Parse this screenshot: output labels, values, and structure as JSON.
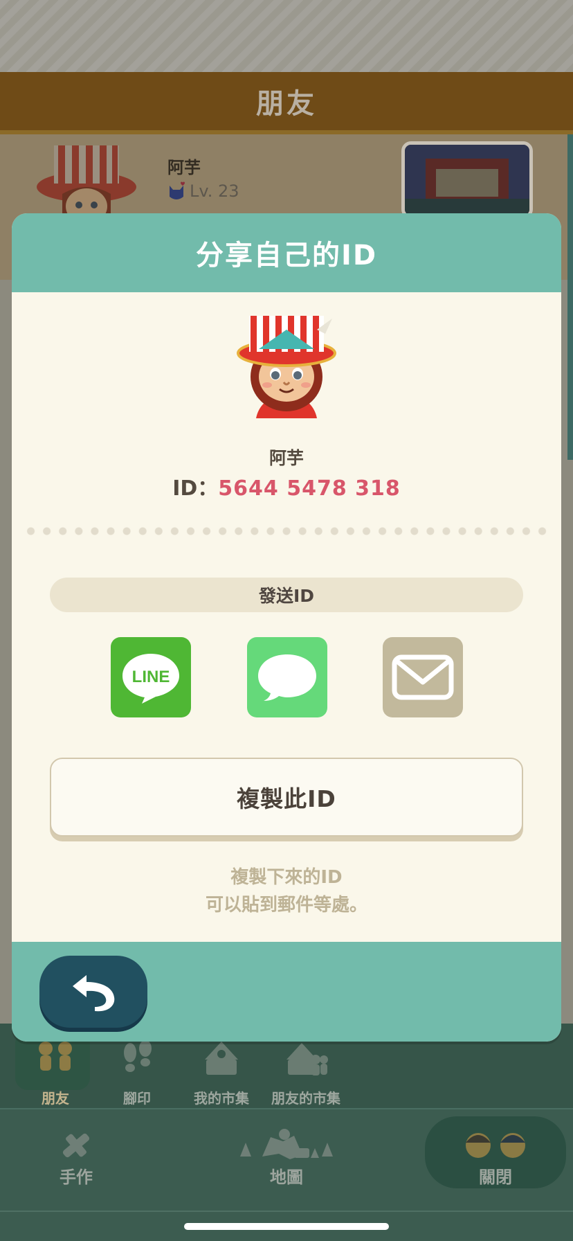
{
  "background": {
    "header_title": "朋友",
    "friend": {
      "name": "阿芋",
      "level": "Lv. 23"
    },
    "tabs": [
      {
        "label": "朋友",
        "icon": "friends-icon",
        "active": true
      },
      {
        "label": "腳印",
        "icon": "footprints-icon",
        "active": false
      },
      {
        "label": "我的市集",
        "icon": "my-market-icon",
        "active": false
      },
      {
        "label": "朋友的市集",
        "icon": "friends-market-icon",
        "active": false
      }
    ],
    "nav": {
      "craft_label": "手作",
      "map_label": "地圖",
      "close_label": "關閉"
    }
  },
  "modal": {
    "title": "分享自己的ID",
    "user_name": "阿芋",
    "id_prefix": "ID：",
    "id_value": "5644 5478 318",
    "send_label": "發送ID",
    "share_options": [
      {
        "name": "LINE",
        "icon": "line-icon",
        "color": "#4fb734"
      },
      {
        "name": "Messages",
        "icon": "message-bubble-icon",
        "color": "#65d97a"
      },
      {
        "name": "Mail",
        "icon": "mail-icon",
        "color": "#c2b99c"
      }
    ],
    "line_logo_text": "LINE",
    "copy_button_label": "複製此ID",
    "hint_line1": "複製下來的ID",
    "hint_line2": "可以貼到郵件等處。",
    "back_icon": "back-arrow-icon"
  },
  "colors": {
    "teal": "#72bbab",
    "cream": "#faf7ea",
    "id_pink": "#d8566a",
    "back_button": "#215060"
  }
}
